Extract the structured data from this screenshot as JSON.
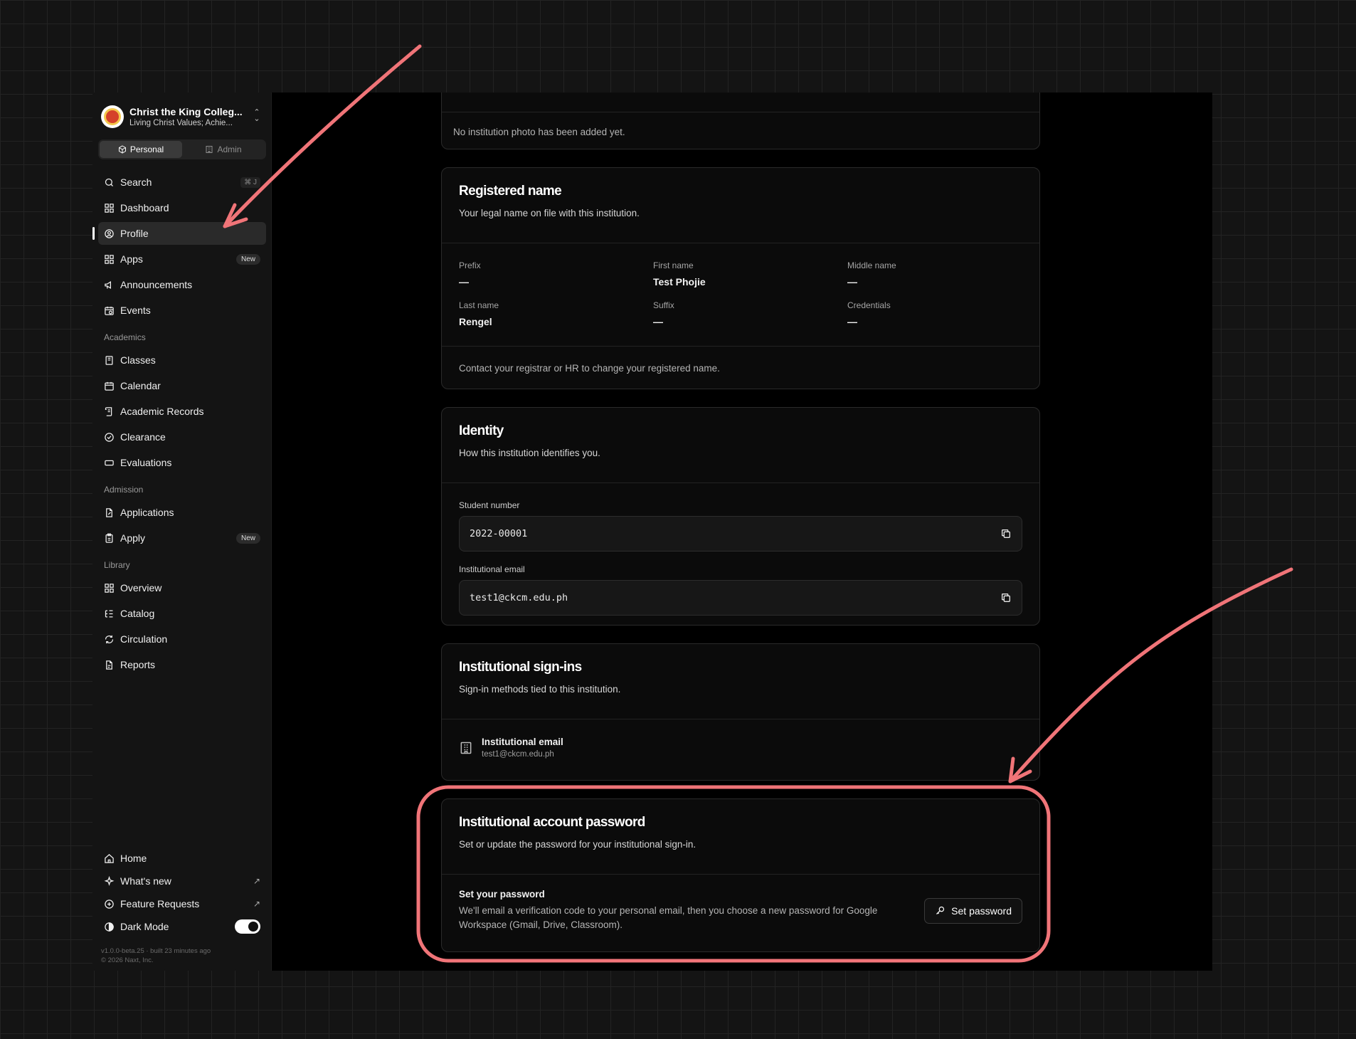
{
  "sidebar": {
    "org_name": "Christ the King Colleg...",
    "org_tagline": "Living Christ Values; Achie...",
    "segments": [
      {
        "label": "Personal"
      },
      {
        "label": "Admin"
      }
    ],
    "search": {
      "label": "Search",
      "shortcut": "⌘ J"
    },
    "main_items": [
      {
        "label": "Dashboard"
      },
      {
        "label": "Profile"
      },
      {
        "label": "Apps",
        "badge": "New"
      },
      {
        "label": "Announcements"
      },
      {
        "label": "Events"
      }
    ],
    "academics": {
      "title": "Academics",
      "items": [
        {
          "label": "Classes"
        },
        {
          "label": "Calendar"
        },
        {
          "label": "Academic Records"
        },
        {
          "label": "Clearance"
        },
        {
          "label": "Evaluations"
        }
      ]
    },
    "admission": {
      "title": "Admission",
      "items": [
        {
          "label": "Applications"
        },
        {
          "label": "Apply",
          "badge": "New"
        }
      ]
    },
    "library": {
      "title": "Library",
      "items": [
        {
          "label": "Overview"
        },
        {
          "label": "Catalog"
        },
        {
          "label": "Circulation"
        },
        {
          "label": "Reports"
        }
      ]
    },
    "bottom": {
      "home": "Home",
      "whats_new": "What's new",
      "feature_requests": "Feature Requests",
      "dark_mode": "Dark Mode",
      "dark_mode_on": true
    },
    "version": "v1.0.0-beta.25 · built 23 minutes ago",
    "copyright": "© 2026 Naxt, Inc."
  },
  "photo_card": {
    "note": "No institution photo has been added yet."
  },
  "registered_name": {
    "title": "Registered name",
    "description": "Your legal name on file with this institution.",
    "fields": [
      {
        "label": "Prefix",
        "value": "—"
      },
      {
        "label": "First name",
        "value": "Test Phojie"
      },
      {
        "label": "Middle name",
        "value": "—"
      },
      {
        "label": "Last name",
        "value": "Rengel"
      },
      {
        "label": "Suffix",
        "value": "—"
      },
      {
        "label": "Credentials",
        "value": "—"
      }
    ],
    "footer": "Contact your registrar or HR to change your registered name."
  },
  "identity": {
    "title": "Identity",
    "description": "How this institution identifies you.",
    "student_number_label": "Student number",
    "student_number": "2022-00001",
    "email_label": "Institutional email",
    "email": "test1@ckcm.edu.ph"
  },
  "sign_ins": {
    "title": "Institutional sign-ins",
    "description": "Sign-in methods tied to this institution.",
    "method_label": "Institutional email",
    "method_value": "test1@ckcm.edu.ph"
  },
  "password": {
    "title": "Institutional account password",
    "description": "Set or update the password for your institutional sign-in.",
    "row_title": "Set your password",
    "row_desc_1": "We'll email a verification code to your personal email, then you choose a new password for Google",
    "row_desc_2": "Workspace (Gmail, Drive, Classroom).",
    "button": "Set password"
  },
  "annotation_color": "#f07478"
}
